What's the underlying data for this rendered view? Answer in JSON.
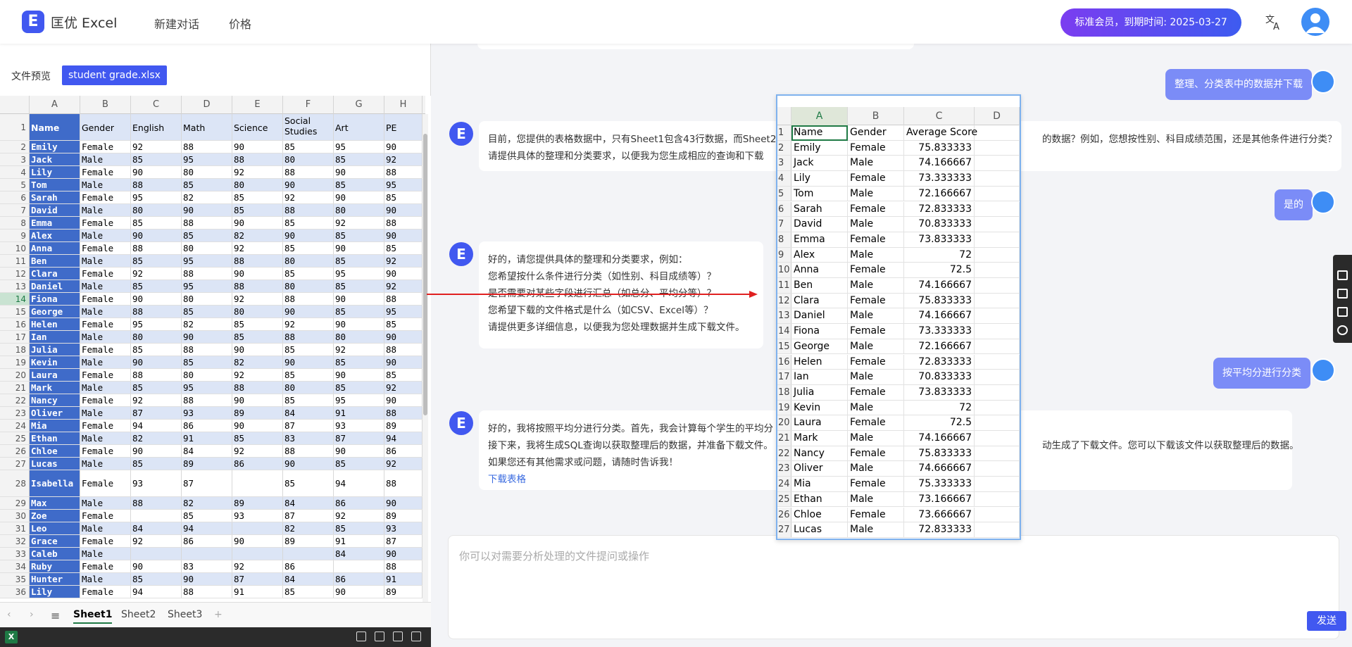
{
  "header": {
    "brand": "匡优 Excel",
    "nav": [
      "新建对话",
      "价格"
    ],
    "member_badge": "标准会员，到期时间: 2025-03-27",
    "translate_icon": "translate-icon",
    "colors": {
      "accent": "#4158f0",
      "gradient_from": "#7b3df0",
      "gradient_to": "#3d5bf0"
    }
  },
  "left_panel": {
    "preview_label": "文件预览",
    "file_name": "student grade.xlsx",
    "columns": [
      "A",
      "B",
      "C",
      "D",
      "E",
      "F",
      "G",
      "H"
    ],
    "header_row": [
      "Name",
      "Gender",
      "English",
      "Math",
      "Science",
      "Social Studies",
      "Art",
      "PE"
    ],
    "rows": [
      [
        "Emily",
        "Female",
        "92",
        "88",
        "90",
        "85",
        "95",
        "90"
      ],
      [
        "Jack",
        "Male",
        "85",
        "95",
        "88",
        "80",
        "85",
        "92"
      ],
      [
        "Lily",
        "Female",
        "90",
        "80",
        "92",
        "88",
        "90",
        "88"
      ],
      [
        "Tom",
        "Male",
        "88",
        "85",
        "80",
        "90",
        "85",
        "95"
      ],
      [
        "Sarah",
        "Female",
        "95",
        "82",
        "85",
        "92",
        "90",
        "85"
      ],
      [
        "David",
        "Male",
        "80",
        "90",
        "85",
        "88",
        "80",
        "90"
      ],
      [
        "Emma",
        "Female",
        "85",
        "88",
        "90",
        "85",
        "92",
        "88"
      ],
      [
        "Alex",
        "Male",
        "90",
        "85",
        "82",
        "90",
        "85",
        "90"
      ],
      [
        "Anna",
        "Female",
        "88",
        "80",
        "92",
        "85",
        "90",
        "85"
      ],
      [
        "Ben",
        "Male",
        "85",
        "95",
        "88",
        "80",
        "85",
        "92"
      ],
      [
        "Clara",
        "Female",
        "92",
        "88",
        "90",
        "85",
        "95",
        "90"
      ],
      [
        "Daniel",
        "Male",
        "85",
        "95",
        "88",
        "80",
        "85",
        "92"
      ],
      [
        "Fiona",
        "Female",
        "90",
        "80",
        "92",
        "88",
        "90",
        "88"
      ],
      [
        "George",
        "Male",
        "88",
        "85",
        "80",
        "90",
        "85",
        "95"
      ],
      [
        "Helen",
        "Female",
        "95",
        "82",
        "85",
        "92",
        "90",
        "85"
      ],
      [
        "Ian",
        "Male",
        "80",
        "90",
        "85",
        "88",
        "80",
        "90"
      ],
      [
        "Julia",
        "Female",
        "85",
        "88",
        "90",
        "85",
        "92",
        "88"
      ],
      [
        "Kevin",
        "Male",
        "90",
        "85",
        "82",
        "90",
        "85",
        "90"
      ],
      [
        "Laura",
        "Female",
        "88",
        "80",
        "92",
        "85",
        "90",
        "85"
      ],
      [
        "Mark",
        "Male",
        "85",
        "95",
        "88",
        "80",
        "85",
        "92"
      ],
      [
        "Nancy",
        "Female",
        "92",
        "88",
        "90",
        "85",
        "95",
        "90"
      ],
      [
        "Oliver",
        "Male",
        "87",
        "93",
        "89",
        "84",
        "91",
        "88"
      ],
      [
        "Mia",
        "Female",
        "94",
        "86",
        "90",
        "87",
        "93",
        "89"
      ],
      [
        "Ethan",
        "Male",
        "82",
        "91",
        "85",
        "83",
        "87",
        "94"
      ],
      [
        "Chloe",
        "Female",
        "90",
        "84",
        "92",
        "88",
        "90",
        "86"
      ],
      [
        "Lucas",
        "Male",
        "85",
        "89",
        "86",
        "90",
        "85",
        "92"
      ],
      [
        "Isabella",
        "Female",
        "93",
        "87",
        "",
        "85",
        "94",
        "88"
      ],
      [
        "Max",
        "Male",
        "88",
        "82",
        "89",
        "84",
        "86",
        "90"
      ],
      [
        "Zoe",
        "Female",
        "",
        "85",
        "93",
        "87",
        "92",
        "89"
      ],
      [
        "Leo",
        "Male",
        "84",
        "94",
        "",
        "82",
        "85",
        "93"
      ],
      [
        "Grace",
        "Female",
        "92",
        "86",
        "90",
        "89",
        "91",
        "87"
      ],
      [
        "Caleb",
        "Male",
        "",
        "",
        "",
        "",
        "84",
        "90"
      ],
      [
        "Ruby",
        "Female",
        "90",
        "83",
        "92",
        "86",
        "",
        "88"
      ],
      [
        "Hunter",
        "Male",
        "85",
        "90",
        "87",
        "84",
        "86",
        "91"
      ],
      [
        "Lily",
        "Female",
        "94",
        "88",
        "91",
        "85",
        "90",
        "89"
      ]
    ],
    "row_numbers": [
      "1",
      "2",
      "3",
      "4",
      "5",
      "6",
      "7",
      "8",
      "9",
      "10",
      "11",
      "12",
      "13",
      "14",
      "15",
      "16",
      "17",
      "18",
      "19",
      "20",
      "21",
      "22",
      "23",
      "24",
      "25",
      "26",
      "27",
      "28",
      "29",
      "30",
      "31",
      "32",
      "33",
      "34",
      "35",
      "36"
    ],
    "sheet_tabs": [
      "Sheet1",
      "Sheet2",
      "Sheet3"
    ],
    "active_tab": "Sheet1"
  },
  "chat": {
    "messages": [
      {
        "role": "user",
        "text": "整理、分类表中的数据并下载"
      },
      {
        "role": "ai",
        "lines": [
          "目前，您提供的表格数据中，只有Sheet1包含43行数据，而Sheet2",
          "请提供具体的整理和分类要求，以便我为您生成相应的查询和下载"
        ],
        "right_lines": [
          "的数据？例如，您想按性别、科目成绩范围，还是其他条件进行分类？"
        ]
      },
      {
        "role": "user",
        "text": "是的"
      },
      {
        "role": "ai",
        "lines": [
          "好的，请您提供具体的整理和分类要求，例如：",
          "您希望按什么条件进行分类（如性别、科目成绩等）？",
          "是否需要对某些字段进行汇总（如总分、平均分等）？",
          "您希望下载的文件格式是什么（如CSV、Excel等）？",
          "请提供更多详细信息，以便我为您处理数据并生成下载文件。"
        ]
      },
      {
        "role": "user",
        "text": "按平均分进行分类"
      },
      {
        "role": "ai",
        "lines": [
          "好的，我将按照平均分进行分类。首先，我会计算每个学生的平均分",
          "接下来，我将生成SQL查询以获取整理后的数据，并准备下载文件。",
          "如果您还有其他需求或问题，请随时告诉我！"
        ],
        "right_lines": [
          "动生成了下载文件。您可以下载该文件以获取整理后的数据。"
        ],
        "link": "下载表格"
      }
    ],
    "composer_placeholder": "你可以对需要分析处理的文件提问或操作",
    "send_label": "发送"
  },
  "overlay_sheet": {
    "columns": [
      "A",
      "B",
      "C",
      "D"
    ],
    "header": [
      "Name",
      "Gender",
      "Average Score"
    ],
    "rows": [
      [
        "Emily",
        "Female",
        "75.833333"
      ],
      [
        "Jack",
        "Male",
        "74.166667"
      ],
      [
        "Lily",
        "Female",
        "73.333333"
      ],
      [
        "Tom",
        "Male",
        "72.166667"
      ],
      [
        "Sarah",
        "Female",
        "72.833333"
      ],
      [
        "David",
        "Male",
        "70.833333"
      ],
      [
        "Emma",
        "Female",
        "73.833333"
      ],
      [
        "Alex",
        "Male",
        "72"
      ],
      [
        "Anna",
        "Female",
        "72.5"
      ],
      [
        "Ben",
        "Male",
        "74.166667"
      ],
      [
        "Clara",
        "Female",
        "75.833333"
      ],
      [
        "Daniel",
        "Male",
        "74.166667"
      ],
      [
        "Fiona",
        "Female",
        "73.333333"
      ],
      [
        "George",
        "Male",
        "72.166667"
      ],
      [
        "Helen",
        "Female",
        "72.833333"
      ],
      [
        "Ian",
        "Male",
        "70.833333"
      ],
      [
        "Julia",
        "Female",
        "73.833333"
      ],
      [
        "Kevin",
        "Male",
        "72"
      ],
      [
        "Laura",
        "Female",
        "72.5"
      ],
      [
        "Mark",
        "Male",
        "74.166667"
      ],
      [
        "Nancy",
        "Female",
        "75.833333"
      ],
      [
        "Oliver",
        "Male",
        "74.666667"
      ],
      [
        "Mia",
        "Female",
        "75.333333"
      ],
      [
        "Ethan",
        "Male",
        "73.166667"
      ],
      [
        "Chloe",
        "Female",
        "73.666667"
      ],
      [
        "Lucas",
        "Male",
        "72.833333"
      ]
    ],
    "row_numbers": [
      "1",
      "2",
      "3",
      "4",
      "5",
      "6",
      "7",
      "8",
      "9",
      "10",
      "11",
      "12",
      "13",
      "14",
      "15",
      "16",
      "17",
      "18",
      "19",
      "20",
      "21",
      "22",
      "23",
      "24",
      "25",
      "26",
      "27"
    ]
  },
  "side_tools": [
    "camera-icon",
    "video-icon",
    "copy-icon",
    "settings-icon"
  ]
}
